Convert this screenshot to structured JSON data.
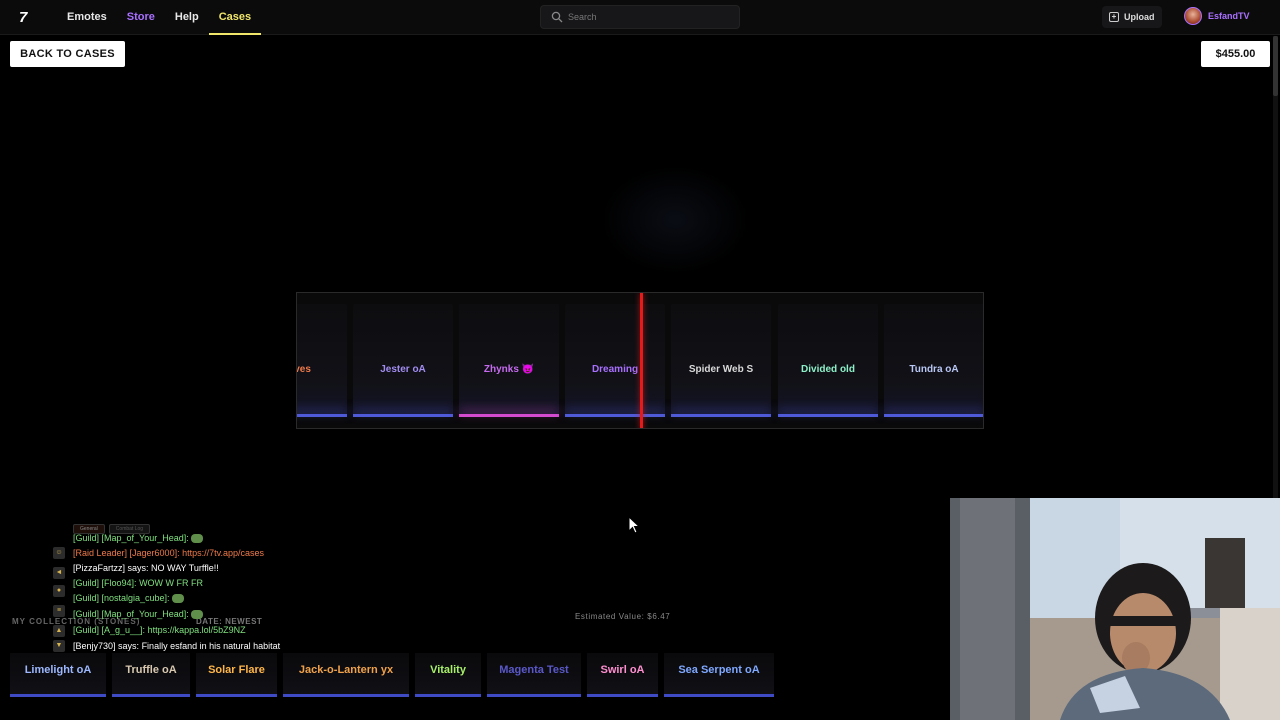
{
  "header": {
    "logo_text": "7",
    "nav": [
      {
        "label": "Emotes"
      },
      {
        "label": "Store"
      },
      {
        "label": "Help"
      },
      {
        "label": "Cases"
      }
    ],
    "search_placeholder": "Search",
    "upload_label": "Upload",
    "username": "EsfandTV"
  },
  "case": {
    "back_label": "BACK TO CASES",
    "balance": "$455.00"
  },
  "roulette": {
    "items": [
      {
        "label": "eaves",
        "color": "#ef7a4a"
      },
      {
        "label": "Jester oA",
        "color": "#a28cf0"
      },
      {
        "label": "Zhynks 😈",
        "color": "#c76bf0"
      },
      {
        "label": "Dreaming",
        "color": "#a970ff"
      },
      {
        "label": "Spider Web S",
        "color": "#d9d9d9"
      },
      {
        "label": "Divided old",
        "color": "#8ef0c8"
      },
      {
        "label": "Tundra oA",
        "color": "#b9c7f5"
      }
    ],
    "marker_color": "#e41b1b"
  },
  "collection": {
    "title": "MY COLLECTION (STONES)",
    "sort_label": "DATE: NEWEST",
    "estimated_value": "Estimated Value: $6.47",
    "items": [
      {
        "label": "Limelight oA",
        "color": "#9db8ff"
      },
      {
        "label": "Truffle oA",
        "color": "#d8c8b0"
      },
      {
        "label": "Solar Flare",
        "color": "#ffb648"
      },
      {
        "label": "Jack-o-Lantern yx",
        "color": "#f0a24a"
      },
      {
        "label": "Vitality",
        "color": "#a8f06a"
      },
      {
        "label": "Magenta Test",
        "color": "#5a58c8"
      },
      {
        "label": "Swirl oA",
        "color": "#ff8fd0"
      },
      {
        "label": "Sea Serpent oA",
        "color": "#7fa8ff"
      }
    ]
  },
  "chat": {
    "tabs": [
      "General",
      "Combat Log"
    ],
    "lines": [
      {
        "prefix": "[Guild] [Map_of_Your_Head]:",
        "text": "",
        "emote": true,
        "kind": "guild"
      },
      {
        "prefix": "[Raid Leader] [Jager6000]:",
        "text": "https://7tv.app/cases",
        "emote": false,
        "kind": "raid"
      },
      {
        "prefix": "[PizzaFartzz] says:",
        "text": "NO WAY Turffle!!",
        "emote": false,
        "kind": "says"
      },
      {
        "prefix": "[Guild] [Floo94]:",
        "text": "WOW W FR FR",
        "emote": false,
        "kind": "guild"
      },
      {
        "prefix": "[Guild] [nostalgia_cube]:",
        "text": "",
        "emote": true,
        "kind": "guild"
      },
      {
        "prefix": "[Guild] [Map_of_Your_Head]:",
        "text": "",
        "emote": true,
        "kind": "guild"
      },
      {
        "prefix": "[Guild] [A_g_u__]:",
        "text": "https://kappa.lol/5bZ9NZ",
        "emote": false,
        "kind": "guild"
      },
      {
        "prefix": "[Benjy730] says:",
        "text": "Finally esfand in his natural habitat",
        "emote": false,
        "kind": "says"
      }
    ]
  }
}
